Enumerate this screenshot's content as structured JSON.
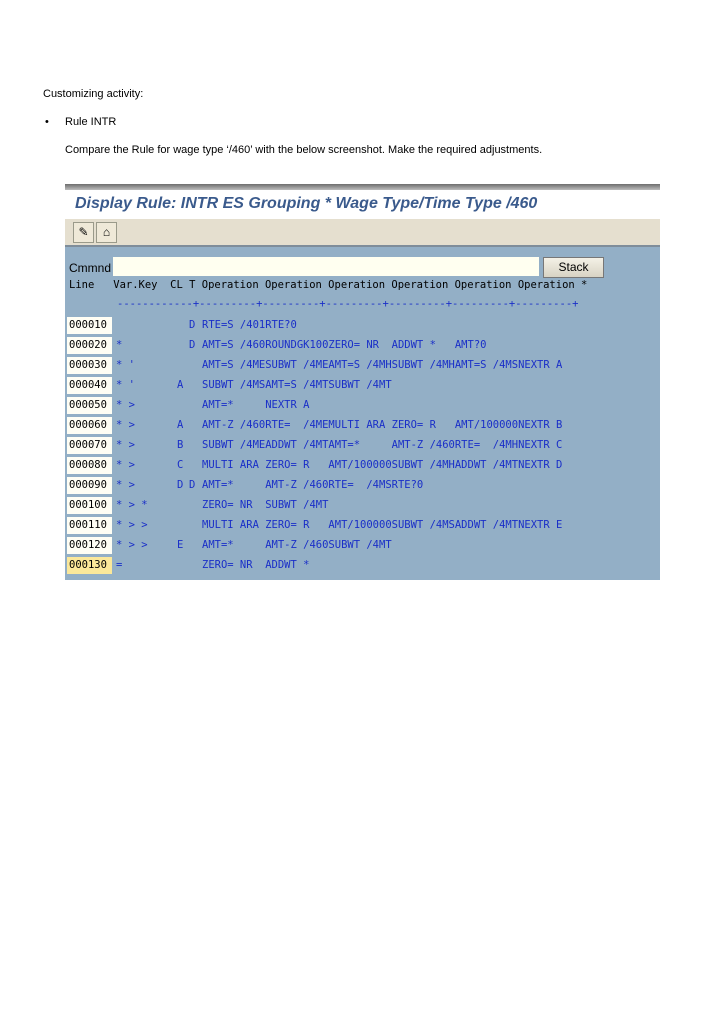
{
  "doc": {
    "heading": "Customizing activity:",
    "bullet": "Rule INTR",
    "instruction": "Compare the Rule for wage type ‘/460’ with the below screenshot. Make the required adjustments."
  },
  "window": {
    "title": "Display Rule: INTR ES Grouping * Wage Type/Time Type /460",
    "toolbar": [
      {
        "icon": "pencil-glasses-icon",
        "glyph": "✎"
      },
      {
        "icon": "hierarchy-icon",
        "glyph": "⌂"
      }
    ],
    "command_label": "Cmmnd",
    "command_value": "",
    "stack_label": "Stack",
    "header": "Line   Var.Key  CL T Operation Operation Operation Operation Operation Operation *",
    "ruler": "------------+---------+---------+---------+---------+---------+---------+",
    "rows": [
      {
        "line": "000010",
        "varkey": "",
        "cl": "",
        "t": "D",
        "op": "RTE=S /401RTE?0"
      },
      {
        "line": "000020",
        "varkey": "*",
        "cl": "",
        "t": "D",
        "op": "AMT=S /460ROUNDGK100ZERO= NR  ADDWT *   AMT?0"
      },
      {
        "line": "000030",
        "varkey": "* '",
        "cl": "",
        "t": "",
        "op": "AMT=S /4MESUBWT /4MEAMT=S /4MHSUBWT /4MHAMT=S /4MSNEXTR A"
      },
      {
        "line": "000040",
        "varkey": "* '",
        "cl": "A",
        "t": "",
        "op": "SUBWT /4MSAMT=S /4MTSUBWT /4MT"
      },
      {
        "line": "000050",
        "varkey": "* >",
        "cl": "",
        "t": "",
        "op": "AMT=*     NEXTR A"
      },
      {
        "line": "000060",
        "varkey": "* >",
        "cl": "A",
        "t": "",
        "op": "AMT-Z /460RTE=  /4MEMULTI ARA ZERO= R   AMT/100000NEXTR B"
      },
      {
        "line": "000070",
        "varkey": "* >",
        "cl": "B",
        "t": "",
        "op": "SUBWT /4MEADDWT /4MTAMT=*     AMT-Z /460RTE=  /4MHNEXTR C"
      },
      {
        "line": "000080",
        "varkey": "* >",
        "cl": "C",
        "t": "",
        "op": "MULTI ARA ZERO= R   AMT/100000SUBWT /4MHADDWT /4MTNEXTR D"
      },
      {
        "line": "000090",
        "varkey": "* >",
        "cl": "D",
        "t": "D",
        "op": "AMT=*     AMT-Z /460RTE=  /4MSRTE?0"
      },
      {
        "line": "000100",
        "varkey": "* > *",
        "cl": "",
        "t": "",
        "op": "ZERO= NR  SUBWT /4MT"
      },
      {
        "line": "000110",
        "varkey": "* > >",
        "cl": "",
        "t": "",
        "op": "MULTI ARA ZERO= R   AMT/100000SUBWT /4MSADDWT /4MTNEXTR E"
      },
      {
        "line": "000120",
        "varkey": "* > >",
        "cl": "E",
        "t": "",
        "op": "AMT=*     AMT-Z /460SUBWT /4MT"
      },
      {
        "line": "000130",
        "varkey": "=",
        "cl": "",
        "t": "",
        "op": "ZERO= NR  ADDWT *",
        "selected": true
      }
    ]
  },
  "colors": {
    "background": "#93afc6",
    "text": "#1a2fc8",
    "title": "#3a5a8c",
    "selected": "#fbe89a"
  }
}
